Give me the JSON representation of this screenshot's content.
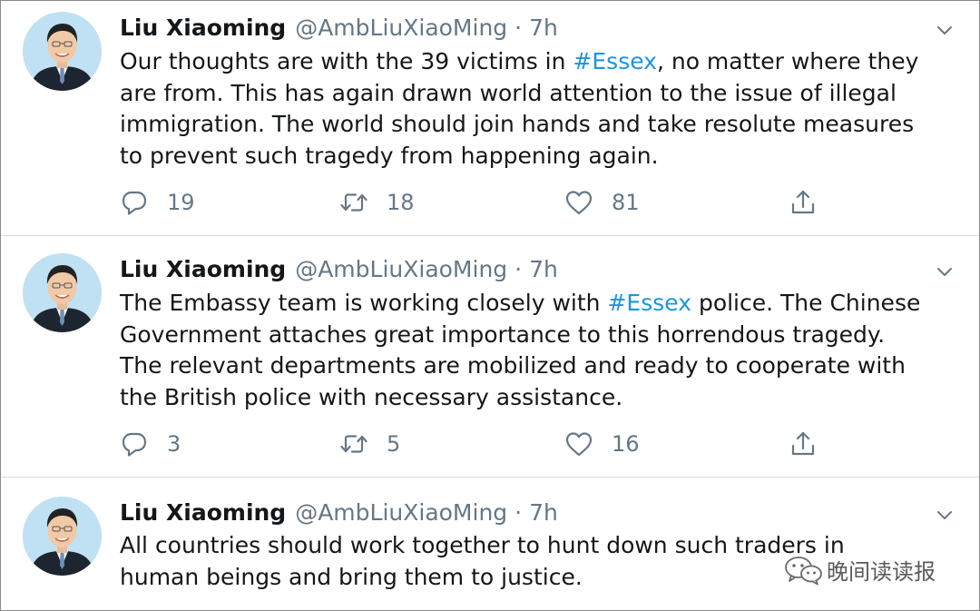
{
  "colors": {
    "text": "#14171a",
    "secondary": "#657786",
    "hashtag": "#1b95e0",
    "divider": "#d9d9d9"
  },
  "tweets": [
    {
      "name": "Liu Xiaoming",
      "handle": "@AmbLiuXiaoMing",
      "separator": "·",
      "time": "7h",
      "text_lines": [
        {
          "before": "Our thoughts are with the 39 victims in ",
          "hashtag": "#Essex",
          "after": ", no matter where they"
        },
        {
          "before": "are from. This has again drawn world attention to the issue of illegal",
          "hashtag": "",
          "after": ""
        },
        {
          "before": "immigration. The world should join hands and take resolute measures",
          "hashtag": "",
          "after": ""
        },
        {
          "before": "to prevent such tragedy from happening again.",
          "hashtag": "",
          "after": ""
        }
      ],
      "replies": "19",
      "retweets": "18",
      "likes": "81",
      "icons": [
        "reply-icon",
        "retweet-icon",
        "like-icon",
        "share-icon",
        "chevron-down-icon"
      ]
    },
    {
      "name": "Liu Xiaoming",
      "handle": "@AmbLiuXiaoMing",
      "separator": "·",
      "time": "7h",
      "text_lines": [
        {
          "before": "The Embassy team is working closely with ",
          "hashtag": "#Essex",
          "after": " police. The Chinese"
        },
        {
          "before": "Government attaches great importance to this horrendous tragedy.",
          "hashtag": "",
          "after": ""
        },
        {
          "before": "The relevant departments are mobilized and ready to cooperate with",
          "hashtag": "",
          "after": ""
        },
        {
          "before": "the British police with necessary assistance.",
          "hashtag": "",
          "after": ""
        }
      ],
      "replies": "3",
      "retweets": "5",
      "likes": "16",
      "icons": [
        "reply-icon",
        "retweet-icon",
        "like-icon",
        "share-icon",
        "chevron-down-icon"
      ]
    },
    {
      "name": "Liu Xiaoming",
      "handle": "@AmbLiuXiaoMing",
      "separator": "·",
      "time": "7h",
      "text_lines": [
        {
          "before": "All countries should work together to hunt down such traders in",
          "hashtag": "",
          "after": ""
        },
        {
          "before": "human beings and bring them to justice.",
          "hashtag": "",
          "after": ""
        }
      ],
      "icons": [
        "chevron-down-icon"
      ]
    }
  ],
  "watermark": {
    "text": "晚间读读报",
    "icon": "wechat-icon"
  }
}
